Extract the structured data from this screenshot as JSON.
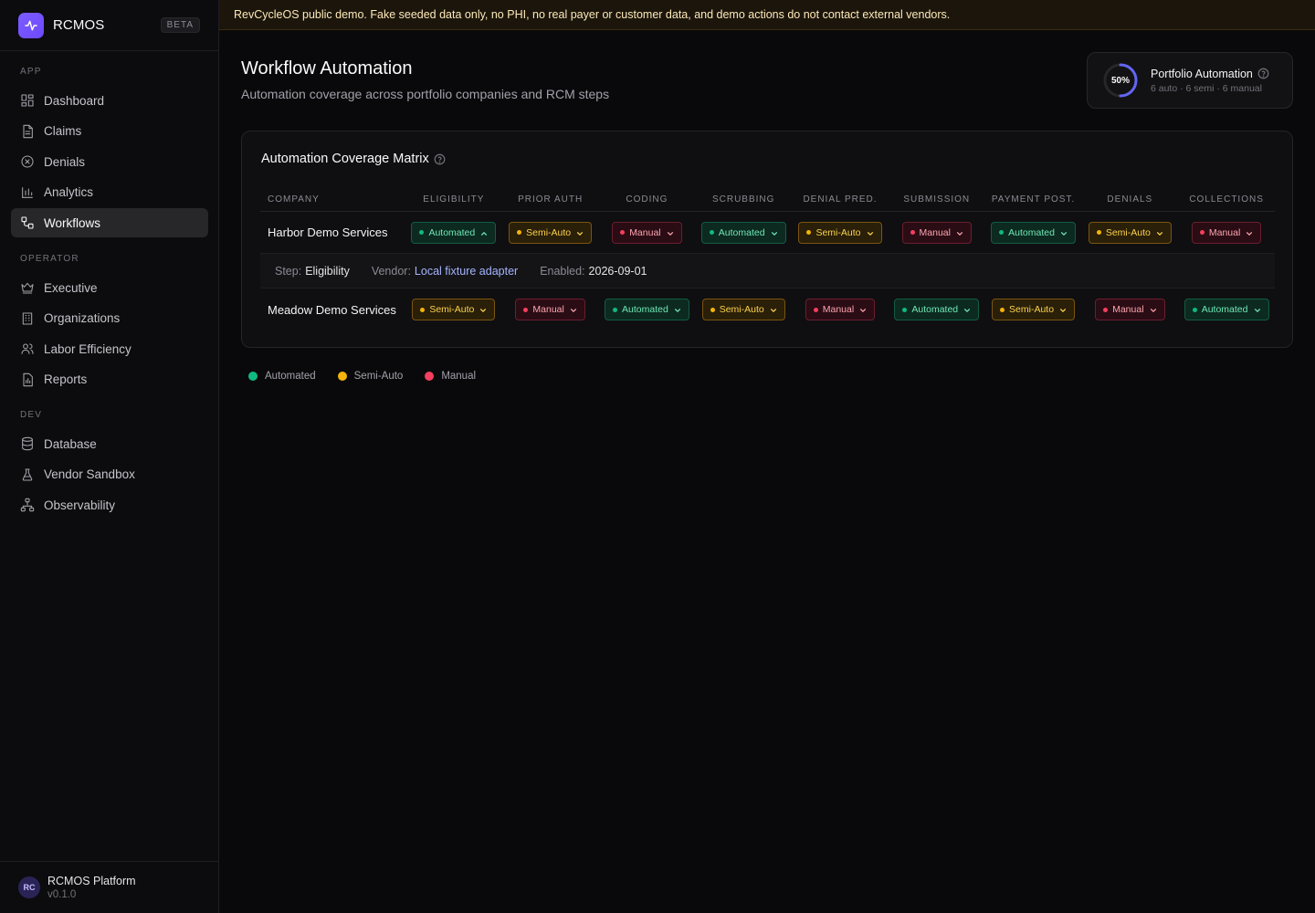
{
  "brand": {
    "name": "RCMOS",
    "badge": "BETA"
  },
  "sidebar": {
    "sections": [
      {
        "label": "APP",
        "items": [
          {
            "label": "Dashboard",
            "icon": "dashboard-icon"
          },
          {
            "label": "Claims",
            "icon": "document-icon"
          },
          {
            "label": "Denials",
            "icon": "x-circle-icon"
          },
          {
            "label": "Analytics",
            "icon": "bar-chart-icon"
          },
          {
            "label": "Workflows",
            "icon": "workflow-icon",
            "active": true
          }
        ]
      },
      {
        "label": "OPERATOR",
        "items": [
          {
            "label": "Executive",
            "icon": "crown-icon"
          },
          {
            "label": "Organizations",
            "icon": "building-icon"
          },
          {
            "label": "Labor Efficiency",
            "icon": "users-icon"
          },
          {
            "label": "Reports",
            "icon": "report-icon"
          }
        ]
      },
      {
        "label": "DEV",
        "items": [
          {
            "label": "Database",
            "icon": "database-icon"
          },
          {
            "label": "Vendor Sandbox",
            "icon": "flask-icon"
          },
          {
            "label": "Observability",
            "icon": "network-icon"
          }
        ]
      }
    ],
    "footer": {
      "avatar": "RC",
      "name": "RCMOS Platform",
      "version": "v0.1.0"
    }
  },
  "banner": {
    "text": "RevCycleOS public demo. Fake seeded data only, no PHI, no real payer or customer data, and demo actions do not contact external vendors."
  },
  "header": {
    "title": "Workflow Automation",
    "subtitle": "Automation coverage across portfolio companies and RCM steps"
  },
  "kpi": {
    "value_label": "50%",
    "value": 0.5,
    "title": "Portfolio Automation",
    "subtitle": "6 auto · 6 semi · 6 manual"
  },
  "matrix": {
    "title": "Automation Coverage Matrix",
    "columns": [
      "COMPANY",
      "ELIGIBILITY",
      "PRIOR AUTH",
      "CODING",
      "SCRUBBING",
      "DENIAL PRED.",
      "SUBMISSION",
      "PAYMENT POST.",
      "DENIALS",
      "COLLECTIONS"
    ],
    "rows": [
      {
        "company": "Harbor Demo Services",
        "cells": [
          {
            "status": "auto",
            "label": "Automated",
            "expanded": true
          },
          {
            "status": "semi",
            "label": "Semi-Auto"
          },
          {
            "status": "manual",
            "label": "Manual"
          },
          {
            "status": "auto",
            "label": "Automated"
          },
          {
            "status": "semi",
            "label": "Semi-Auto"
          },
          {
            "status": "manual",
            "label": "Manual"
          },
          {
            "status": "auto",
            "label": "Automated"
          },
          {
            "status": "semi",
            "label": "Semi-Auto"
          },
          {
            "status": "manual",
            "label": "Manual"
          }
        ],
        "detail": {
          "step_label": "Step:",
          "step_value": "Eligibility",
          "vendor_label": "Vendor:",
          "vendor_value": "Local fixture adapter",
          "enabled_label": "Enabled:",
          "enabled_value": "2026-09-01"
        }
      },
      {
        "company": "Meadow Demo Services",
        "cells": [
          {
            "status": "semi",
            "label": "Semi-Auto"
          },
          {
            "status": "manual",
            "label": "Manual"
          },
          {
            "status": "auto",
            "label": "Automated"
          },
          {
            "status": "semi",
            "label": "Semi-Auto"
          },
          {
            "status": "manual",
            "label": "Manual"
          },
          {
            "status": "auto",
            "label": "Automated"
          },
          {
            "status": "semi",
            "label": "Semi-Auto"
          },
          {
            "status": "manual",
            "label": "Manual"
          },
          {
            "status": "auto",
            "label": "Automated"
          }
        ]
      }
    ]
  },
  "legend": [
    {
      "label": "Automated",
      "color": "#10b981"
    },
    {
      "label": "Semi-Auto",
      "color": "#f5b30b"
    },
    {
      "label": "Manual",
      "color": "#f43f5e"
    }
  ],
  "colors": {
    "accent": "#7c5cff",
    "automated": "#10b981",
    "semi_auto": "#f5b30b",
    "manual": "#f43f5e"
  }
}
